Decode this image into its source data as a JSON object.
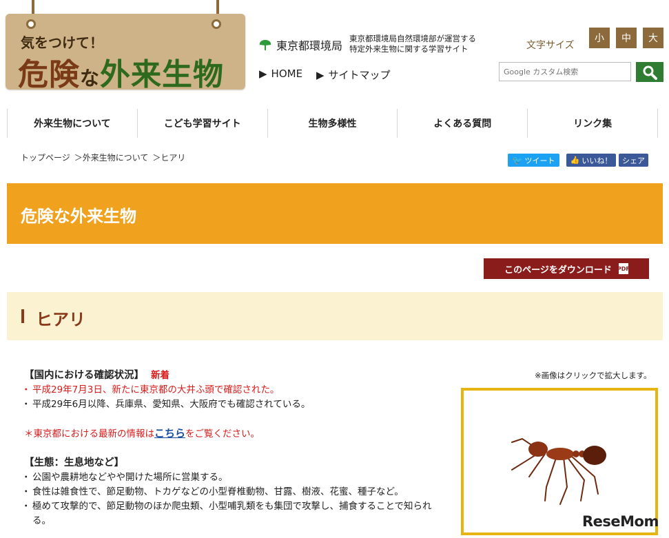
{
  "logo": {
    "small": "気をつけて！",
    "big_a": "危険",
    "big_na": "な",
    "big_b": "外来生物"
  },
  "header": {
    "bureau_name": "東京都環境局",
    "bureau_desc_line1": "東京都環境局自然環境部が運営する",
    "bureau_desc_line2": "特定外来生物に関する学習サイト",
    "nav_home": "HOME",
    "nav_sitemap": "サイトマップ",
    "fontsize_label": "文字サイズ",
    "fontsize_small": "小",
    "fontsize_medium": "中",
    "fontsize_large": "大",
    "search_placeholder": "Google カスタム検索"
  },
  "gnav": [
    "外来生物について",
    "こども学習サイト",
    "生物多様性",
    "よくある質問",
    "リンク集"
  ],
  "breadcrumb": [
    "トップページ",
    "＞外来生物について",
    "＞ヒアリ"
  ],
  "social": {
    "tweet": "ツイート",
    "like": "いいね！",
    "share": "シェア"
  },
  "page_title": "危険な外来生物",
  "download_label": "このページをダウンロード",
  "pdf_label": "PDF",
  "section_title": "ヒアリ",
  "image_note": "※画像はクリックで拡大します。",
  "content": {
    "h1": "【国内における確認状況】",
    "new_badge": "新着",
    "status_1": "平成29年7月3日、新たに東京都の大井ふ頭で確認された。",
    "status_2": "平成29年6月以降、兵庫県、愛知県、大阪府でも確認されている。",
    "notice_pre": "＊東京都における最新の情報は",
    "notice_link": "こちら",
    "notice_post": "をご覧ください。",
    "h2": "【生態：生息地など】",
    "eco_1": "公園や農耕地などやや開けた場所に営巣する。",
    "eco_2": "食性は雑食性で、節足動物、トカゲなどの小型脊椎動物、甘露、樹液、花蜜、種子など。",
    "eco_3": "極めて攻撃的で、節足動物のほか爬虫類、小型哺乳類をも集団で攻撃し、捕食することで知られる。"
  },
  "watermark": "ReseMom",
  "colors": {
    "banner": "#f0a21e",
    "section_bg": "#fbf2d2",
    "accent_brown": "#8a3a1a",
    "download": "#8a1c1c",
    "twitter": "#1da1f2",
    "facebook": "#3b5998"
  }
}
